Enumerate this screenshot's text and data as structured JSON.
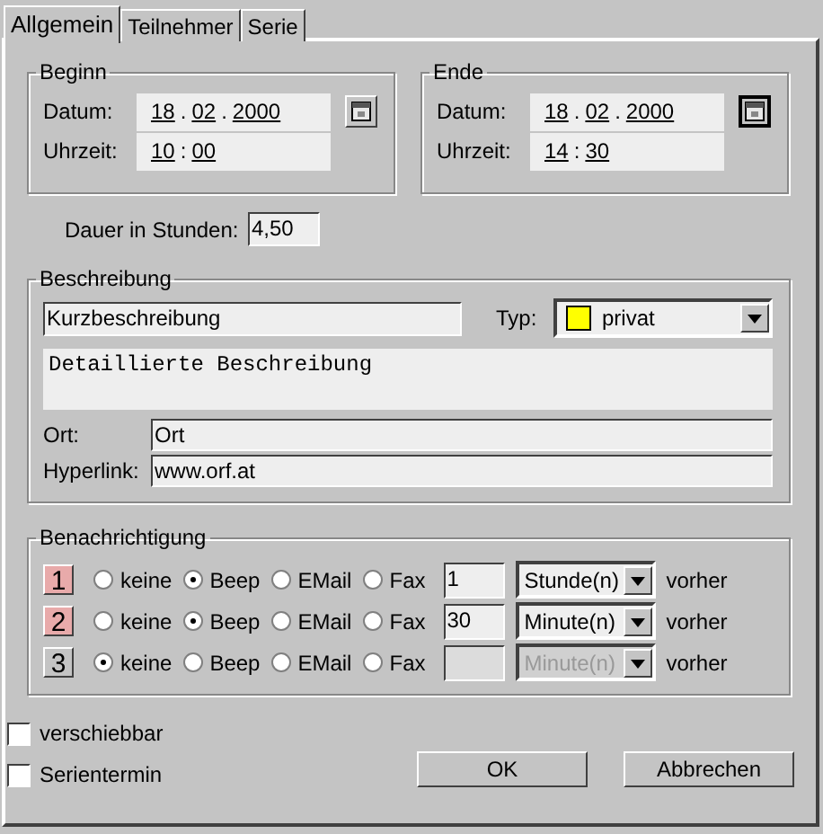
{
  "tabs": [
    {
      "label": "Allgemein",
      "selected": true
    },
    {
      "label": "Teilnehmer",
      "selected": false
    },
    {
      "label": "Serie",
      "selected": false
    }
  ],
  "beginn": {
    "title": "Beginn",
    "date_label": "Datum:",
    "date": [
      "18",
      "02",
      "2000"
    ],
    "date_separator": ".",
    "time_label": "Uhrzeit:",
    "time": [
      "10",
      "00"
    ],
    "time_separator": ":"
  },
  "ende": {
    "title": "Ende",
    "date_label": "Datum:",
    "date": [
      "18",
      "02",
      "2000"
    ],
    "date_separator": ".",
    "time_label": "Uhrzeit:",
    "time": [
      "14",
      "30"
    ],
    "time_separator": ":"
  },
  "duration": {
    "label": "Dauer in Stunden:",
    "value": "4,50"
  },
  "beschreibung": {
    "title": "Beschreibung",
    "short": "Kurzbeschreibung",
    "type_label": "Typ:",
    "type": {
      "label": "privat",
      "color": "#ffff00"
    },
    "details": "Detaillierte Beschreibung",
    "place_label": "Ort:",
    "place": "Ort",
    "link_label": "Hyperlink:",
    "link": "www.orf.at"
  },
  "notifications": {
    "title": "Benachrichtigung",
    "rows": [
      {
        "number": "1",
        "enabled": true,
        "options": [
          {
            "label": "keine",
            "selected": false
          },
          {
            "label": "Beep",
            "selected": true
          },
          {
            "label": "EMail",
            "selected": false
          },
          {
            "label": "Fax",
            "selected": false
          }
        ],
        "amount": "1",
        "unit": "Stunde(n)",
        "suffix": "vorher"
      },
      {
        "number": "2",
        "enabled": true,
        "options": [
          {
            "label": "keine",
            "selected": false
          },
          {
            "label": "Beep",
            "selected": true
          },
          {
            "label": "EMail",
            "selected": false
          },
          {
            "label": "Fax",
            "selected": false
          }
        ],
        "amount": "30",
        "unit": "Minute(n)",
        "suffix": "vorher"
      },
      {
        "number": "3",
        "enabled": false,
        "options": [
          {
            "label": "keine",
            "selected": true
          },
          {
            "label": "Beep",
            "selected": false
          },
          {
            "label": "EMail",
            "selected": false
          },
          {
            "label": "Fax",
            "selected": false
          }
        ],
        "unit": "Minute(n)",
        "suffix": "vorher"
      }
    ]
  },
  "checkboxes": [
    {
      "label": "verschiebbar",
      "checked": false
    },
    {
      "label": "Serientermin",
      "checked": false
    }
  ],
  "buttons": [
    "OK",
    "Abbrechen"
  ]
}
